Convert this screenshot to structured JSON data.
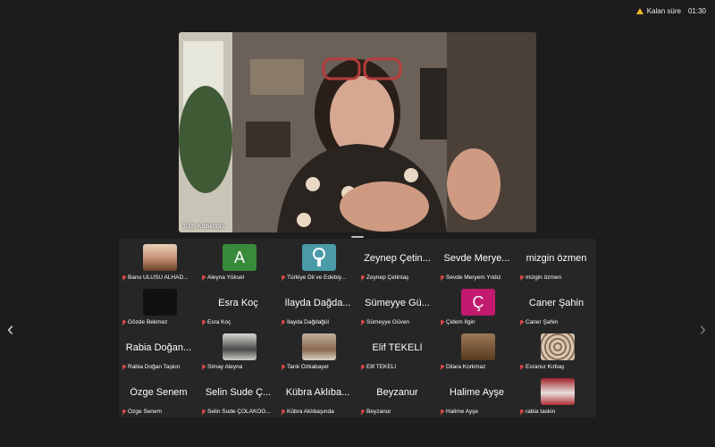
{
  "timer": {
    "label": "Kalan süre",
    "time": "01:30"
  },
  "speaker": {
    "name": "Tulin Kozikoglu"
  },
  "participants": [
    {
      "label": "Banu ULUSU ALHAD...",
      "avatar": "photo"
    },
    {
      "label": "Aleyna Yüksel",
      "avatar": "letter",
      "letter": "A"
    },
    {
      "label": "Türkiye Dil ve Edebiy...",
      "avatar": "logo"
    },
    {
      "label": "Zeynep Çetintaş",
      "display": "Zeynep Çetin..."
    },
    {
      "label": "Sevde Meryem Yıldız",
      "display": "Sevde Merye..."
    },
    {
      "label": "mizgin özmen",
      "display": "mizgin özmen"
    },
    {
      "label": "Gözde Bekmez",
      "avatar": "dark"
    },
    {
      "label": "Esra Koç",
      "display": "Esra Koç"
    },
    {
      "label": "İlayda Dağdağül",
      "display": "İlayda Dağda..."
    },
    {
      "label": "Sümeyye Güven",
      "display": "Sümeyye Gü..."
    },
    {
      "label": "Çidem İlgin",
      "avatar": "letter",
      "letter": "Ç"
    },
    {
      "label": "Caner Şahin",
      "display": "Caner Şahin"
    },
    {
      "label": "Rabia Doğan Taşkın",
      "display": "Rabia Doğan..."
    },
    {
      "label": "Simay Aleyna",
      "avatar": "photo"
    },
    {
      "label": "Tarık Özkabayel",
      "avatar": "photo"
    },
    {
      "label": "Elif TEKELİ",
      "display": "Elif TEKELİ"
    },
    {
      "label": "Dilara Korkmaz",
      "avatar": "photo"
    },
    {
      "label": "Esranur Kırbaş",
      "avatar": "photo"
    },
    {
      "label": "Özge Senem",
      "display": "Özge Senem"
    },
    {
      "label": "Selin Sude ÇOLAKOĞ...",
      "display": "Selin Sude Ç..."
    },
    {
      "label": "Kübra Aklıbaşında",
      "display": "Kübra Aklıba..."
    },
    {
      "label": "Beyzanur",
      "display": "Beyzanur"
    },
    {
      "label": "Halime Ayşe",
      "display": "Halime Ayşe"
    },
    {
      "label": "rabia taskin",
      "avatar": "photo"
    }
  ],
  "nav": {
    "prev": "‹",
    "next": "›"
  }
}
